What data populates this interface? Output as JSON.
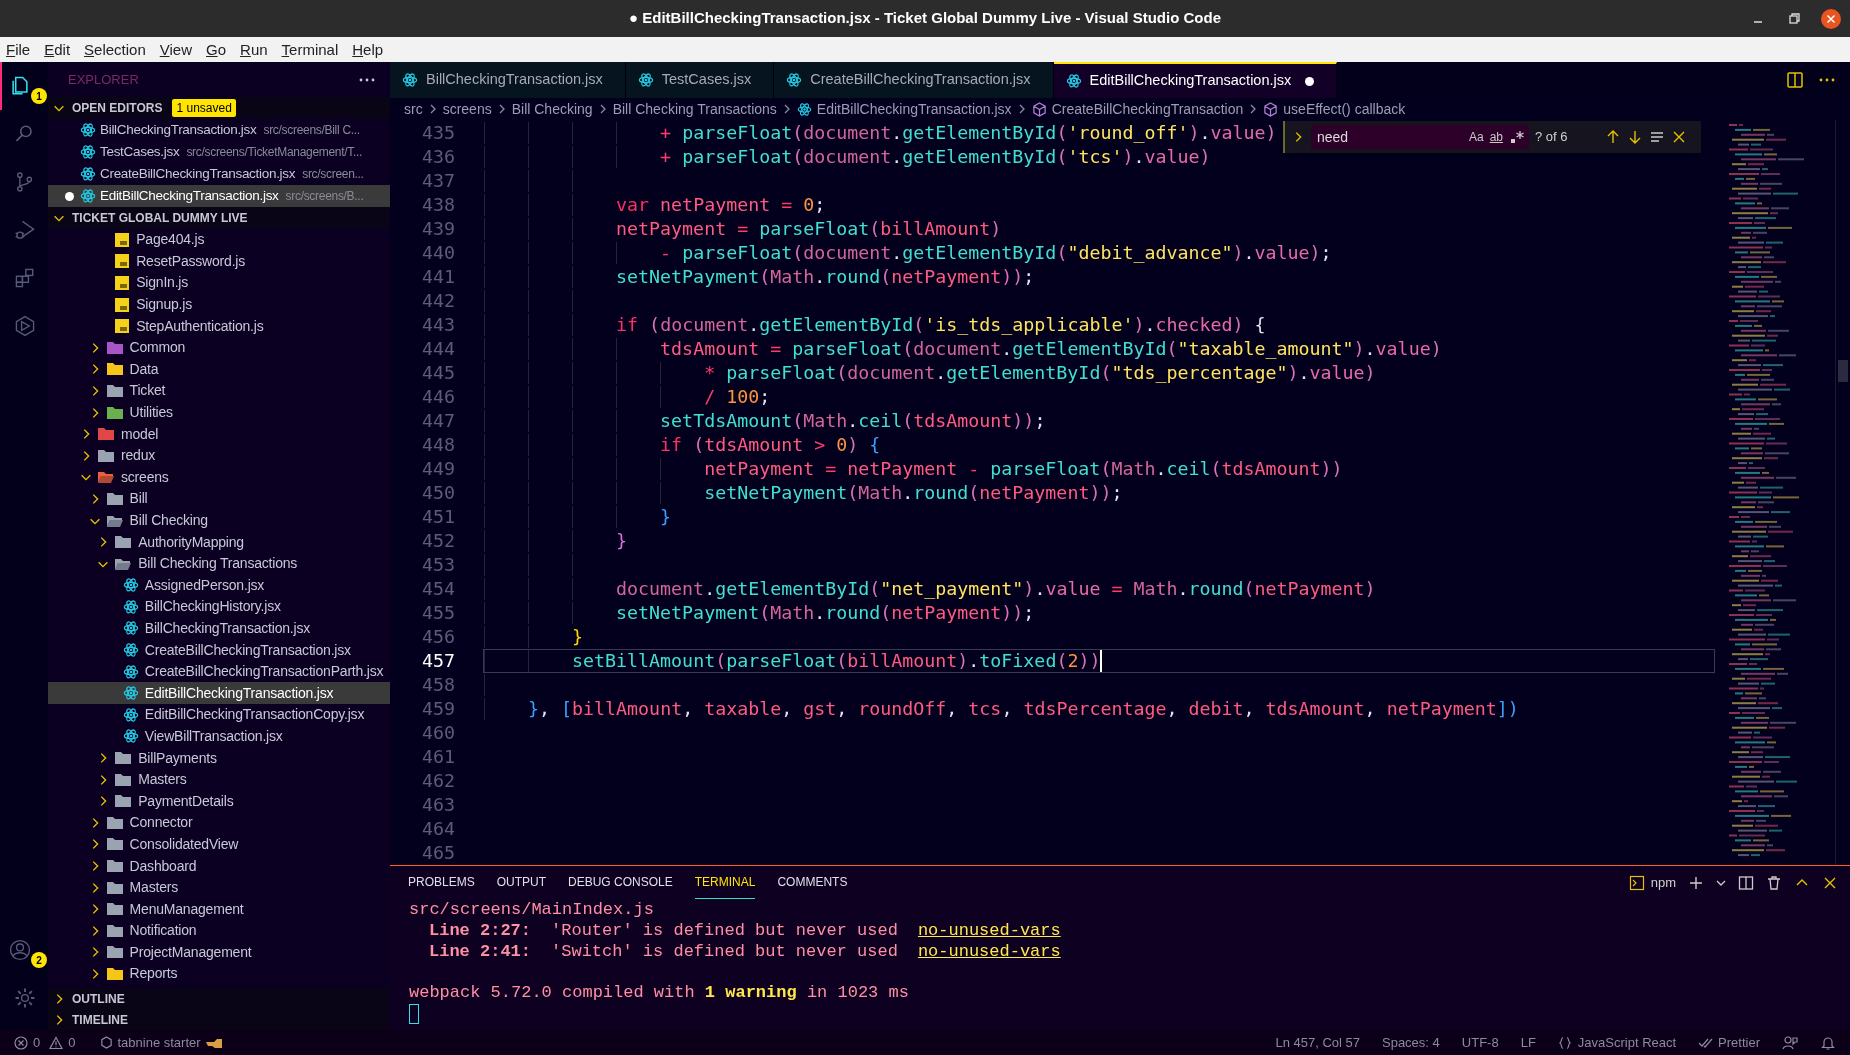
{
  "window": {
    "title": "● EditBillCheckingTransaction.jsx - Ticket Global Dummy Live - Visual Studio Code"
  },
  "menu": [
    "File",
    "Edit",
    "Selection",
    "View",
    "Go",
    "Run",
    "Terminal",
    "Help"
  ],
  "activity_bar": {
    "top": [
      {
        "kind": "explorer",
        "selected": true,
        "badge": "1"
      },
      {
        "kind": "search",
        "selected": false
      },
      {
        "kind": "source-control",
        "selected": false
      },
      {
        "kind": "run-debug",
        "selected": false
      },
      {
        "kind": "extensions",
        "selected": false
      },
      {
        "kind": "remote",
        "selected": false
      }
    ],
    "bottom": [
      {
        "kind": "accounts",
        "badge": "2"
      },
      {
        "kind": "settings"
      }
    ]
  },
  "explorer": {
    "title": "EXPLORER",
    "open_editors": {
      "label": "OPEN EDITORS",
      "badge": "1 unsaved",
      "items": [
        {
          "name": "BillCheckingTransaction.jsx",
          "path": "src/screens/Bill C...",
          "dirty": false,
          "selected": false
        },
        {
          "name": "TestCases.jsx",
          "path": "src/screens/TicketManagement/T...",
          "dirty": false,
          "selected": false
        },
        {
          "name": "CreateBillCheckingTransaction.jsx",
          "path": "src/screen...",
          "dirty": false,
          "selected": false
        },
        {
          "name": "EditBillCheckingTransaction.jsx",
          "path": "src/screens/B...",
          "dirty": true,
          "selected": true
        }
      ]
    },
    "workspace": {
      "label": "TICKET GLOBAL DUMMY LIVE",
      "tree": [
        {
          "children": [
            {
              "children": [
                {
                  "label": "Page404.js",
                  "kind": "js",
                  "selected": false
                },
                {
                  "label": "ResetPassword.js",
                  "kind": "js",
                  "selected": false
                },
                {
                  "label": "SignIn.js",
                  "kind": "js",
                  "selected": false
                },
                {
                  "label": "Signup.js",
                  "kind": "js",
                  "selected": false
                },
                {
                  "label": "StepAuthentication.js",
                  "kind": "js",
                  "selected": false
                }
              ]
            },
            {
              "label": "Common",
              "kind": "folder",
              "color": "#a855c8",
              "expanded": false,
              "selected": false
            },
            {
              "label": "Data",
              "kind": "folder",
              "color": "#f5c518",
              "expanded": false,
              "selected": false
            },
            {
              "label": "Ticket",
              "kind": "folder",
              "color": "#9aa4b0",
              "expanded": false,
              "selected": false
            },
            {
              "label": "Utilities",
              "kind": "folder",
              "color": "#6ab04c",
              "expanded": false,
              "selected": false
            }
          ]
        },
        {
          "label": "model",
          "kind": "folder",
          "color": "#e04848",
          "expanded": false,
          "selected": false
        },
        {
          "label": "redux",
          "kind": "folder",
          "color": "#9aa4b0",
          "expanded": false,
          "selected": false
        },
        {
          "label": "screens",
          "kind": "folder",
          "color": "#e8603c",
          "expanded": true,
          "selected": false,
          "children": [
            {
              "label": "Bill",
              "kind": "folder",
              "color": "#9aa4b0",
              "expanded": false,
              "selected": false
            },
            {
              "label": "Bill Checking",
              "kind": "folder",
              "color": "#9aa4b0",
              "expanded": true,
              "selected": false,
              "children": [
                {
                  "label": "AuthorityMapping",
                  "kind": "folder",
                  "color": "#9aa4b0",
                  "expanded": false,
                  "selected": false
                },
                {
                  "label": "Bill Checking Transactions",
                  "kind": "folder",
                  "color": "#9aa4b0",
                  "expanded": true,
                  "selected": false,
                  "children": [
                    {
                      "label": "AssignedPerson.jsx",
                      "kind": "jsx",
                      "selected": false
                    },
                    {
                      "label": "BillCheckingHistory.jsx",
                      "kind": "jsx",
                      "selected": false
                    },
                    {
                      "label": "BillCheckingTransaction.jsx",
                      "kind": "jsx",
                      "selected": false
                    },
                    {
                      "label": "CreateBillCheckingTransaction.jsx",
                      "kind": "jsx",
                      "selected": false
                    },
                    {
                      "label": "CreateBillCheckingTransactionParth.jsx",
                      "kind": "jsx",
                      "selected": false
                    },
                    {
                      "label": "EditBillCheckingTransaction.jsx",
                      "kind": "jsx",
                      "selected": true
                    },
                    {
                      "label": "EditBillCheckingTransactionCopy.jsx",
                      "kind": "jsx",
                      "selected": false
                    },
                    {
                      "label": "ViewBillTransaction.jsx",
                      "kind": "jsx",
                      "selected": false
                    }
                  ]
                },
                {
                  "label": "BillPayments",
                  "kind": "folder",
                  "color": "#9aa4b0",
                  "expanded": false,
                  "selected": false
                },
                {
                  "label": "Masters",
                  "kind": "folder",
                  "color": "#9aa4b0",
                  "expanded": false,
                  "selected": false
                },
                {
                  "label": "PaymentDetails",
                  "kind": "folder",
                  "color": "#9aa4b0",
                  "expanded": false,
                  "selected": false
                }
              ]
            },
            {
              "label": "Connector",
              "kind": "folder",
              "color": "#9aa4b0",
              "expanded": false,
              "selected": false
            },
            {
              "label": "ConsolidatedView",
              "kind": "folder",
              "color": "#9aa4b0",
              "expanded": false,
              "selected": false
            },
            {
              "label": "Dashboard",
              "kind": "folder",
              "color": "#9aa4b0",
              "expanded": false,
              "selected": false
            },
            {
              "label": "Masters",
              "kind": "folder",
              "color": "#9aa4b0",
              "expanded": false,
              "selected": false
            },
            {
              "label": "MenuManagement",
              "kind": "folder",
              "color": "#9aa4b0",
              "expanded": false,
              "selected": false
            },
            {
              "label": "Notification",
              "kind": "folder",
              "color": "#9aa4b0",
              "expanded": false,
              "selected": false
            },
            {
              "label": "ProjectManagement",
              "kind": "folder",
              "color": "#9aa4b0",
              "expanded": false,
              "selected": false
            },
            {
              "label": "Reports",
              "kind": "folder",
              "color": "#f5c518",
              "expanded": false,
              "selected": false
            }
          ]
        }
      ]
    },
    "sections": [
      "OUTLINE",
      "TIMELINE"
    ]
  },
  "tabs": [
    {
      "label": "BillCheckingTransaction.jsx",
      "selected": false,
      "dirty": false
    },
    {
      "label": "TestCases.jsx",
      "selected": false,
      "dirty": false
    },
    {
      "label": "CreateBillCheckingTransaction.jsx",
      "selected": false,
      "dirty": false
    },
    {
      "label": "EditBillCheckingTransaction.jsx",
      "selected": true,
      "dirty": true
    }
  ],
  "breadcrumbs": [
    {
      "label": "src",
      "kind": "folder"
    },
    {
      "label": "screens",
      "kind": "folder"
    },
    {
      "label": "Bill Checking",
      "kind": "folder"
    },
    {
      "label": "Bill Checking Transactions",
      "kind": "folder"
    },
    {
      "label": "EditBillCheckingTransaction.jsx",
      "kind": "file"
    },
    {
      "label": "CreateBillCheckingTransaction",
      "kind": "symbol"
    },
    {
      "label": "useEffect() callback",
      "kind": "symbol"
    }
  ],
  "find": {
    "value": "need",
    "options": [
      "Aa",
      "ab"
    ],
    "result": "? of 6"
  },
  "code": [
    {
      "number": "435",
      "current": false,
      "tokens": [
        {
          "kind": "op",
          "text": "                + "
        },
        {
          "kind": "fn",
          "text": "parseFloat"
        },
        {
          "kind": "paren",
          "text": "("
        },
        {
          "kind": "obj",
          "text": "document"
        },
        {
          "kind": "punct",
          "text": "."
        },
        {
          "kind": "fn",
          "text": "getElementById"
        },
        {
          "kind": "paren",
          "text": "("
        },
        {
          "kind": "str",
          "text": "'round_off'"
        },
        {
          "kind": "paren",
          "text": ")"
        },
        {
          "kind": "punct",
          "text": "."
        },
        {
          "kind": "prop",
          "text": "value"
        },
        {
          "kind": "paren",
          "text": ")"
        }
      ]
    },
    {
      "number": "436",
      "current": false,
      "tokens": [
        {
          "kind": "op",
          "text": "                + "
        },
        {
          "kind": "fn",
          "text": "parseFloat"
        },
        {
          "kind": "paren",
          "text": "("
        },
        {
          "kind": "obj",
          "text": "document"
        },
        {
          "kind": "punct",
          "text": "."
        },
        {
          "kind": "fn",
          "text": "getElementById"
        },
        {
          "kind": "paren",
          "text": "("
        },
        {
          "kind": "str",
          "text": "'tcs'"
        },
        {
          "kind": "paren",
          "text": ")"
        },
        {
          "kind": "punct",
          "text": "."
        },
        {
          "kind": "prop",
          "text": "value"
        },
        {
          "kind": "paren",
          "text": ")"
        }
      ]
    },
    {
      "number": "437",
      "current": false
    },
    {
      "number": "438",
      "current": false,
      "tokens": [
        {
          "kind": "kw",
          "text": "            var "
        },
        {
          "kind": "var",
          "text": "netPayment"
        },
        {
          "kind": "op",
          "text": " = "
        },
        {
          "kind": "num",
          "text": "0"
        },
        {
          "kind": "punct",
          "text": ";"
        }
      ]
    },
    {
      "number": "439",
      "current": false,
      "tokens": [
        {
          "kind": "var",
          "text": "            netPayment"
        },
        {
          "kind": "op",
          "text": " = "
        },
        {
          "kind": "fn",
          "text": "parseFloat"
        },
        {
          "kind": "paren",
          "text": "("
        },
        {
          "kind": "var",
          "text": "billAmount"
        },
        {
          "kind": "paren",
          "text": ")"
        }
      ]
    },
    {
      "number": "440",
      "current": false,
      "tokens": [
        {
          "kind": "op",
          "text": "                - "
        },
        {
          "kind": "fn",
          "text": "parseFloat"
        },
        {
          "kind": "paren",
          "text": "("
        },
        {
          "kind": "obj",
          "text": "document"
        },
        {
          "kind": "punct",
          "text": "."
        },
        {
          "kind": "fn",
          "text": "getElementById"
        },
        {
          "kind": "paren",
          "text": "("
        },
        {
          "kind": "str",
          "text": "\"debit_advance\""
        },
        {
          "kind": "paren",
          "text": ")"
        },
        {
          "kind": "punct",
          "text": "."
        },
        {
          "kind": "prop",
          "text": "value"
        },
        {
          "kind": "paren",
          "text": ")"
        },
        {
          "kind": "punct",
          "text": ";"
        }
      ]
    },
    {
      "number": "441",
      "current": false,
      "tokens": [
        {
          "kind": "fn",
          "text": "            setNetPayment"
        },
        {
          "kind": "paren",
          "text": "("
        },
        {
          "kind": "obj",
          "text": "Math"
        },
        {
          "kind": "punct",
          "text": "."
        },
        {
          "kind": "fn",
          "text": "round"
        },
        {
          "kind": "paren",
          "text": "("
        },
        {
          "kind": "var",
          "text": "netPayment"
        },
        {
          "kind": "paren",
          "text": "))"
        },
        {
          "kind": "punct",
          "text": ";"
        }
      ]
    },
    {
      "number": "442",
      "current": false
    },
    {
      "number": "443",
      "current": false,
      "tokens": [
        {
          "kind": "kw",
          "text": "            if "
        },
        {
          "kind": "paren",
          "text": "("
        },
        {
          "kind": "obj",
          "text": "document"
        },
        {
          "kind": "punct",
          "text": "."
        },
        {
          "kind": "fn",
          "text": "getElementById"
        },
        {
          "kind": "paren",
          "text": "("
        },
        {
          "kind": "str",
          "text": "'is_tds_applicable'"
        },
        {
          "kind": "paren",
          "text": ")"
        },
        {
          "kind": "punct",
          "text": "."
        },
        {
          "kind": "prop",
          "text": "checked"
        },
        {
          "kind": "paren",
          "text": ")"
        },
        {
          "kind": "punct",
          "text": " {"
        }
      ]
    },
    {
      "number": "444",
      "current": false,
      "tokens": [
        {
          "kind": "var",
          "text": "                tdsAmount"
        },
        {
          "kind": "op",
          "text": " = "
        },
        {
          "kind": "fn",
          "text": "parseFloat"
        },
        {
          "kind": "paren",
          "text": "("
        },
        {
          "kind": "obj",
          "text": "document"
        },
        {
          "kind": "punct",
          "text": "."
        },
        {
          "kind": "fn",
          "text": "getElementById"
        },
        {
          "kind": "paren",
          "text": "("
        },
        {
          "kind": "str",
          "text": "\"taxable_amount\""
        },
        {
          "kind": "paren",
          "text": ")"
        },
        {
          "kind": "punct",
          "text": "."
        },
        {
          "kind": "prop",
          "text": "value"
        },
        {
          "kind": "paren",
          "text": ")"
        }
      ]
    },
    {
      "number": "445",
      "current": false,
      "tokens": [
        {
          "kind": "op",
          "text": "                    * "
        },
        {
          "kind": "fn",
          "text": "parseFloat"
        },
        {
          "kind": "paren",
          "text": "("
        },
        {
          "kind": "obj",
          "text": "document"
        },
        {
          "kind": "punct",
          "text": "."
        },
        {
          "kind": "fn",
          "text": "getElementById"
        },
        {
          "kind": "paren",
          "text": "("
        },
        {
          "kind": "str",
          "text": "\"tds_percentage\""
        },
        {
          "kind": "paren",
          "text": ")"
        },
        {
          "kind": "punct",
          "text": "."
        },
        {
          "kind": "prop",
          "text": "value"
        },
        {
          "kind": "paren",
          "text": ")"
        }
      ]
    },
    {
      "number": "446",
      "current": false,
      "tokens": [
        {
          "kind": "op",
          "text": "                    / "
        },
        {
          "kind": "num",
          "text": "100"
        },
        {
          "kind": "punct",
          "text": ";"
        }
      ]
    },
    {
      "number": "447",
      "current": false,
      "tokens": [
        {
          "kind": "fn",
          "text": "                setTdsAmount"
        },
        {
          "kind": "paren",
          "text": "("
        },
        {
          "kind": "obj",
          "text": "Math"
        },
        {
          "kind": "punct",
          "text": "."
        },
        {
          "kind": "fn",
          "text": "ceil"
        },
        {
          "kind": "paren",
          "text": "("
        },
        {
          "kind": "var",
          "text": "tdsAmount"
        },
        {
          "kind": "paren",
          "text": "))"
        },
        {
          "kind": "punct",
          "text": ";"
        }
      ]
    },
    {
      "number": "448",
      "current": false,
      "tokens": [
        {
          "kind": "kw",
          "text": "                if "
        },
        {
          "kind": "paren",
          "text": "("
        },
        {
          "kind": "var",
          "text": "tdsAmount"
        },
        {
          "kind": "op",
          "text": " > "
        },
        {
          "kind": "num",
          "text": "0"
        },
        {
          "kind": "paren",
          "text": ")"
        },
        {
          "kind": "brace3",
          "text": " {"
        }
      ]
    },
    {
      "number": "449",
      "current": false,
      "tokens": [
        {
          "kind": "var",
          "text": "                    netPayment"
        },
        {
          "kind": "op",
          "text": " = "
        },
        {
          "kind": "var",
          "text": "netPayment"
        },
        {
          "kind": "op",
          "text": " - "
        },
        {
          "kind": "fn",
          "text": "parseFloat"
        },
        {
          "kind": "paren",
          "text": "("
        },
        {
          "kind": "obj",
          "text": "Math"
        },
        {
          "kind": "punct",
          "text": "."
        },
        {
          "kind": "fn",
          "text": "ceil"
        },
        {
          "kind": "paren",
          "text": "("
        },
        {
          "kind": "var",
          "text": "tdsAmount"
        },
        {
          "kind": "paren",
          "text": "))"
        }
      ]
    },
    {
      "number": "450",
      "current": false,
      "tokens": [
        {
          "kind": "fn",
          "text": "                    setNetPayment"
        },
        {
          "kind": "paren",
          "text": "("
        },
        {
          "kind": "obj",
          "text": "Math"
        },
        {
          "kind": "punct",
          "text": "."
        },
        {
          "kind": "fn",
          "text": "round"
        },
        {
          "kind": "paren",
          "text": "("
        },
        {
          "kind": "var",
          "text": "netPayment"
        },
        {
          "kind": "paren",
          "text": "))"
        },
        {
          "kind": "punct",
          "text": ";"
        }
      ]
    },
    {
      "number": "451",
      "current": false,
      "tokens": [
        {
          "kind": "brace3",
          "text": "                }"
        }
      ]
    },
    {
      "number": "452",
      "current": false,
      "tokens": [
        {
          "kind": "brace2",
          "text": "            }"
        }
      ]
    },
    {
      "number": "453",
      "current": false
    },
    {
      "number": "454",
      "current": false,
      "tokens": [
        {
          "kind": "obj",
          "text": "            document"
        },
        {
          "kind": "punct",
          "text": "."
        },
        {
          "kind": "fn",
          "text": "getElementById"
        },
        {
          "kind": "paren",
          "text": "("
        },
        {
          "kind": "str",
          "text": "\"net_payment\""
        },
        {
          "kind": "paren",
          "text": ")"
        },
        {
          "kind": "punct",
          "text": "."
        },
        {
          "kind": "prop",
          "text": "value"
        },
        {
          "kind": "op",
          "text": " = "
        },
        {
          "kind": "obj",
          "text": "Math"
        },
        {
          "kind": "punct",
          "text": "."
        },
        {
          "kind": "fn",
          "text": "round"
        },
        {
          "kind": "paren",
          "text": "("
        },
        {
          "kind": "var",
          "text": "netPayment"
        },
        {
          "kind": "paren",
          "text": ")"
        }
      ]
    },
    {
      "number": "455",
      "current": false,
      "tokens": [
        {
          "kind": "fn",
          "text": "            setNetPayment"
        },
        {
          "kind": "paren",
          "text": "("
        },
        {
          "kind": "obj",
          "text": "Math"
        },
        {
          "kind": "punct",
          "text": "."
        },
        {
          "kind": "fn",
          "text": "round"
        },
        {
          "kind": "paren",
          "text": "("
        },
        {
          "kind": "var",
          "text": "netPayment"
        },
        {
          "kind": "paren",
          "text": "))"
        },
        {
          "kind": "punct",
          "text": ";"
        }
      ]
    },
    {
      "number": "456",
      "current": false,
      "tokens": [
        {
          "kind": "brace1",
          "text": "        }"
        }
      ]
    },
    {
      "number": "457",
      "current": true,
      "tokens": [
        {
          "kind": "fn",
          "text": "        setBillAmount"
        },
        {
          "kind": "paren",
          "text": "("
        },
        {
          "kind": "fn",
          "text": "parseFloat"
        },
        {
          "kind": "paren",
          "text": "("
        },
        {
          "kind": "var",
          "text": "billAmount"
        },
        {
          "kind": "paren",
          "text": ")"
        },
        {
          "kind": "punct",
          "text": "."
        },
        {
          "kind": "fn",
          "text": "toFixed"
        },
        {
          "kind": "paren",
          "text": "("
        },
        {
          "kind": "num",
          "text": "2"
        },
        {
          "kind": "paren",
          "text": "))"
        }
      ]
    },
    {
      "number": "458",
      "current": false
    },
    {
      "number": "459",
      "current": false,
      "tokens": [
        {
          "kind": "brace3",
          "text": "    }"
        },
        {
          "kind": "punct",
          "text": ", "
        },
        {
          "kind": "brace3",
          "text": "["
        },
        {
          "kind": "var",
          "text": "billAmount"
        },
        {
          "kind": "punct",
          "text": ", "
        },
        {
          "kind": "var",
          "text": "taxable"
        },
        {
          "kind": "punct",
          "text": ", "
        },
        {
          "kind": "var",
          "text": "gst"
        },
        {
          "kind": "punct",
          "text": ", "
        },
        {
          "kind": "var",
          "text": "roundOff"
        },
        {
          "kind": "punct",
          "text": ", "
        },
        {
          "kind": "var",
          "text": "tcs"
        },
        {
          "kind": "punct",
          "text": ", "
        },
        {
          "kind": "var",
          "text": "tdsPercentage"
        },
        {
          "kind": "punct",
          "text": ", "
        },
        {
          "kind": "var",
          "text": "debit"
        },
        {
          "kind": "punct",
          "text": ", "
        },
        {
          "kind": "var",
          "text": "tdsAmount"
        },
        {
          "kind": "punct",
          "text": ", "
        },
        {
          "kind": "var",
          "text": "netPayment"
        },
        {
          "kind": "brace3",
          "text": "])"
        }
      ]
    },
    {
      "number": "460",
      "current": false
    },
    {
      "number": "461",
      "current": false
    },
    {
      "number": "462",
      "current": false
    },
    {
      "number": "463",
      "current": false
    },
    {
      "number": "464",
      "current": false
    },
    {
      "number": "465",
      "current": false
    }
  ],
  "panel": {
    "tabs": [
      {
        "label": "PROBLEMS",
        "selected": false
      },
      {
        "label": "OUTPUT",
        "selected": false
      },
      {
        "label": "DEBUG CONSOLE",
        "selected": false
      },
      {
        "label": "TERMINAL",
        "selected": true
      },
      {
        "label": "COMMENTS",
        "selected": false
      }
    ],
    "terminal_name": "npm",
    "terminal": {
      "file": "src/screens/MainIndex.js",
      "problems": [
        {
          "location": "Line 2:27:",
          "message": "'Router' is defined but never used",
          "rule": "no-unused-vars"
        },
        {
          "location": "Line 2:41:",
          "message": "'Switch' is defined but never used",
          "rule": "no-unused-vars"
        }
      ],
      "summary": "webpack 5.72.0 compiled with **1 warning** in 1023 ms"
    }
  },
  "status_bar": {
    "errors": "0",
    "warnings": "0",
    "tabnine": "tabnine starter",
    "position": "Ln 457, Col 57",
    "indentation": "Spaces: 4",
    "encoding": "UTF-8",
    "eol": "LF",
    "language": "JavaScript React",
    "formatter": "Prettier"
  }
}
